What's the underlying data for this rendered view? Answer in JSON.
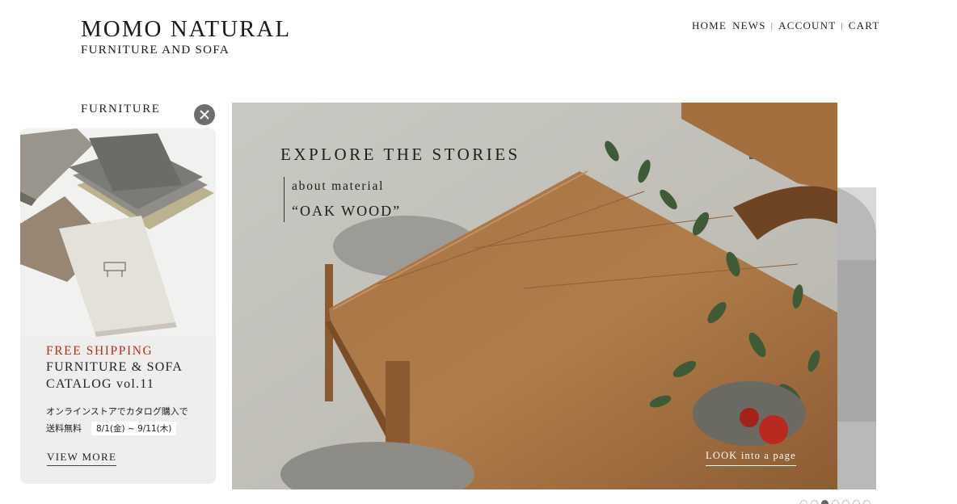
{
  "brand": {
    "name": "MOMO NATURAL",
    "tagline": "FURNITURE AND SOFA"
  },
  "nav": {
    "items": [
      {
        "label": "HOME"
      },
      {
        "label": "NEWS"
      },
      {
        "label": "ACCOUNT"
      },
      {
        "label": "CART"
      }
    ],
    "separator": "|"
  },
  "section": {
    "label": "FURNITURE"
  },
  "promo": {
    "icons": {
      "close": "close-icon"
    },
    "free_shipping": "FREE SHIPPING",
    "title_line1": "FURNITURE & SOFA",
    "title_line2": "CATALOG vol.11",
    "jp_line1": "オンラインストアでカタログ購入で",
    "jp_line2": "送料無料",
    "date": "8/1(金) ~ 9/11(木)",
    "cta": "VIEW MORE",
    "colors": {
      "accent": "#b8301f",
      "background": "#eeeeed"
    }
  },
  "hero": {
    "title": "EXPLORE THE STORIES",
    "subtitle": "about material",
    "quote": "“OAK WOOD”",
    "cta": "LOOK into a page"
  },
  "carousel": {
    "dot_count": 7,
    "active_index": 2
  }
}
